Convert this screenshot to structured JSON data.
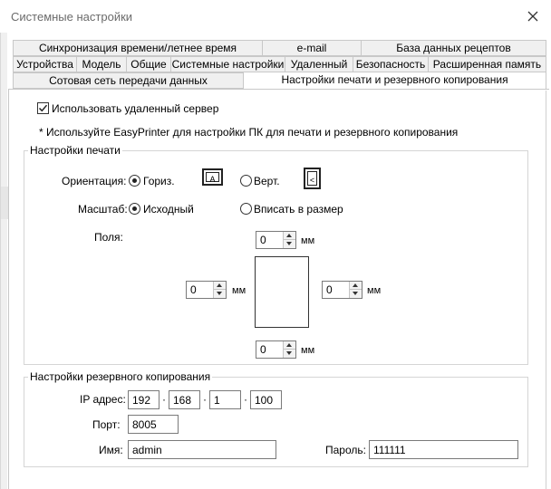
{
  "window": {
    "title": "Системные настройки"
  },
  "tabs": {
    "row1": [
      "Синхронизация времени/летнее время",
      "e-mail",
      "База данных рецептов"
    ],
    "row2": [
      "Устройства",
      "Модель",
      "Общие",
      "Системные настройки",
      "Удаленный",
      "Безопасность",
      "Расширенная память"
    ],
    "row3": [
      "Сотовая сеть передачи данных",
      "Настройки печати и резервного копирования"
    ]
  },
  "remote": {
    "use_remote_label": "Использовать удаленный сервер",
    "use_remote_checked": true,
    "note": "* Используйте EasyPrinter для настройки ПК для печати и резервного копирования"
  },
  "print": {
    "group_title": "Настройки печати",
    "orientation_label": "Ориентация:",
    "orient_landscape": "Гориз.",
    "orient_portrait": "Верт.",
    "orient_selected": "landscape",
    "scale_label": "Масштаб:",
    "scale_original": "Исходный",
    "scale_fit": "Вписать в размер",
    "scale_selected": "original",
    "margins_label": "Поля:",
    "margin_top": "0",
    "margin_left": "0",
    "margin_right": "0",
    "margin_bottom": "0",
    "unit": "мм"
  },
  "backup": {
    "group_title": "Настройки резервного копирования",
    "ip_label": "IP адрес:",
    "ip": [
      "192",
      "168",
      "1",
      "100"
    ],
    "ip_separator": "·",
    "port_label": "Порт:",
    "port": "8005",
    "name_label": "Имя:",
    "name": "admin",
    "password_label": "Пароль:",
    "password": "111111"
  }
}
